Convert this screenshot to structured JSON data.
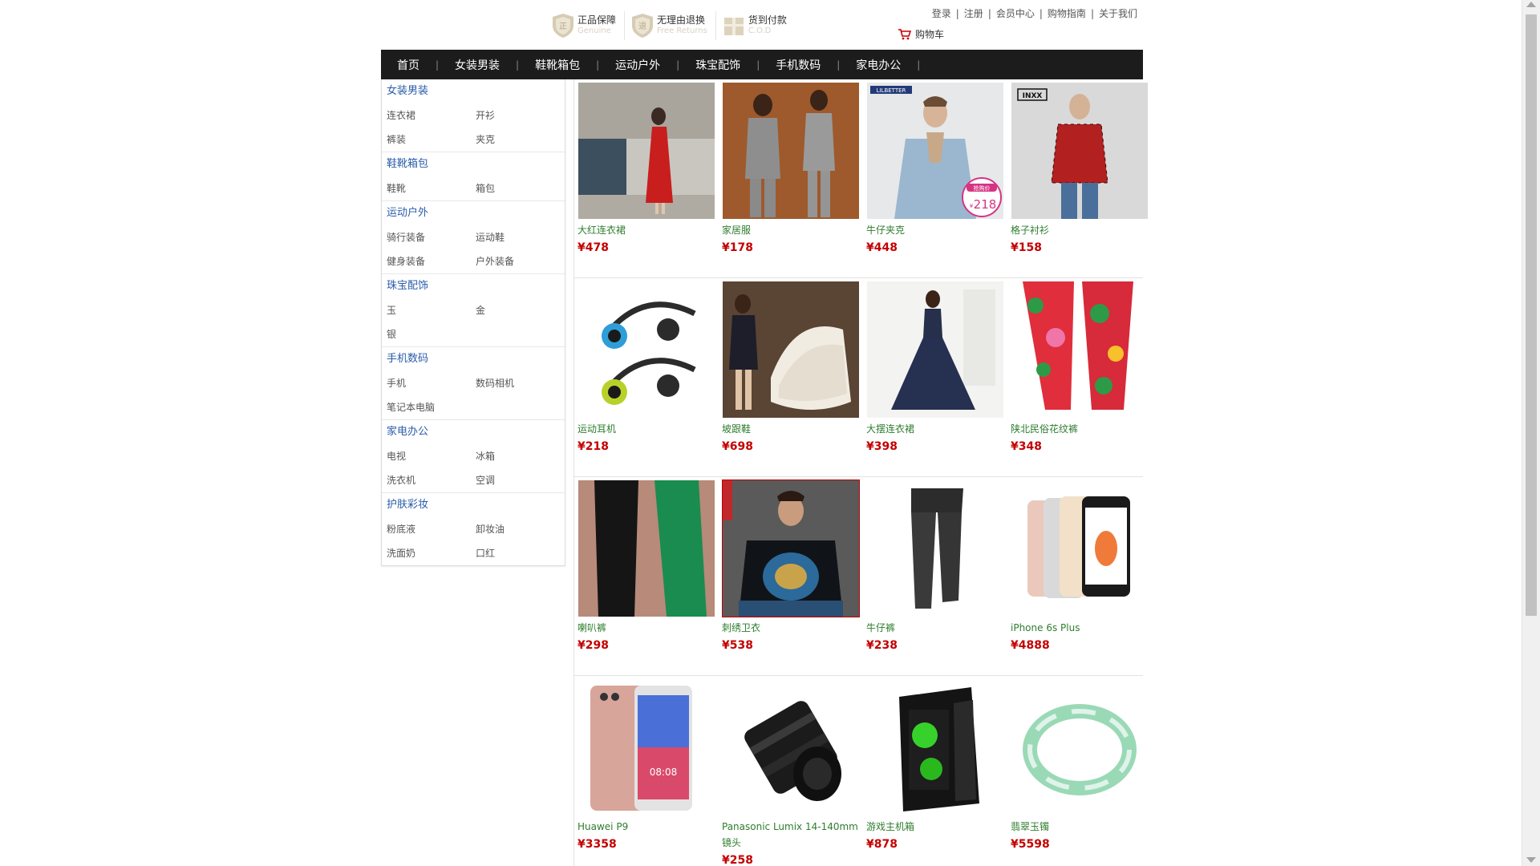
{
  "guarantees": [
    {
      "cn": "正品保障",
      "en": "Genuine",
      "icon": "shield-icon"
    },
    {
      "cn": "无理由退换",
      "en": "Free Returns",
      "icon": "shield-icon"
    },
    {
      "cn": "货到付款",
      "en": "C.O.D",
      "icon": "box-icon"
    }
  ],
  "toplinks": [
    "登录",
    "注册",
    "会员中心",
    "购物指南",
    "关于我们"
  ],
  "cart": {
    "label": "购物车",
    "icon": "cart-icon",
    "color": "#c40000"
  },
  "nav": [
    "首页",
    "女装男装",
    "鞋靴箱包",
    "运动户外",
    "珠宝配饰",
    "手机数码",
    "家电办公"
  ],
  "categories": [
    {
      "title": "女装男装",
      "items": [
        "连衣裙",
        "开衫",
        "裤装",
        "夹克"
      ]
    },
    {
      "title": "鞋靴箱包",
      "items": [
        "鞋靴",
        "箱包"
      ]
    },
    {
      "title": "运动户外",
      "items": [
        "骑行装备",
        "运动鞋",
        "健身装备",
        "户外装备"
      ]
    },
    {
      "title": "珠宝配饰",
      "items": [
        "玉",
        "金",
        "银"
      ]
    },
    {
      "title": "手机数码",
      "items": [
        "手机",
        "数码相机",
        "笔记本电脑"
      ]
    },
    {
      "title": "家电办公",
      "items": [
        "电视",
        "冰箱",
        "洗衣机",
        "空调"
      ]
    },
    {
      "title": "护肤彩妆",
      "items": [
        "粉底液",
        "卸妆油",
        "洗面奶",
        "口红"
      ]
    }
  ],
  "products": [
    [
      {
        "name": "大红连衣裙",
        "price": "¥478"
      },
      {
        "name": "家居服",
        "price": "¥178"
      },
      {
        "name": "牛仔夹克",
        "price": "¥448",
        "badge": {
          "label": "抢购价",
          "currency": "¥",
          "amount": "218"
        },
        "brand": "LILBETTER"
      },
      {
        "name": "格子衬衫",
        "price": "¥158",
        "brand": "INXX"
      }
    ],
    [
      {
        "name": "运动耳机",
        "price": "¥218"
      },
      {
        "name": "坡跟鞋",
        "price": "¥698"
      },
      {
        "name": "大摆连衣裙",
        "price": "¥398"
      },
      {
        "name": "陕北民俗花纹裤",
        "price": "¥348"
      }
    ],
    [
      {
        "name": "喇叭裤",
        "price": "¥298"
      },
      {
        "name": "刺绣卫衣",
        "price": "¥538",
        "selected": true
      },
      {
        "name": "牛仔裤",
        "price": "¥238"
      },
      {
        "name": "iPhone 6s Plus",
        "price": "¥4888"
      }
    ],
    [
      {
        "name": "Huawei P9",
        "price": "¥3358",
        "screen_time": "08:08"
      },
      {
        "name": "Panasonic Lumix 14-140mm镜头",
        "price": "¥258"
      },
      {
        "name": "游戏主机箱",
        "price": "¥878"
      },
      {
        "name": "翡翠玉镯",
        "price": "¥5598"
      }
    ]
  ],
  "colors": {
    "nav_bg": "#1c1c1c",
    "category_title": "#2a5caa",
    "product_name": "#2e7d2e",
    "price": "#c40000"
  }
}
